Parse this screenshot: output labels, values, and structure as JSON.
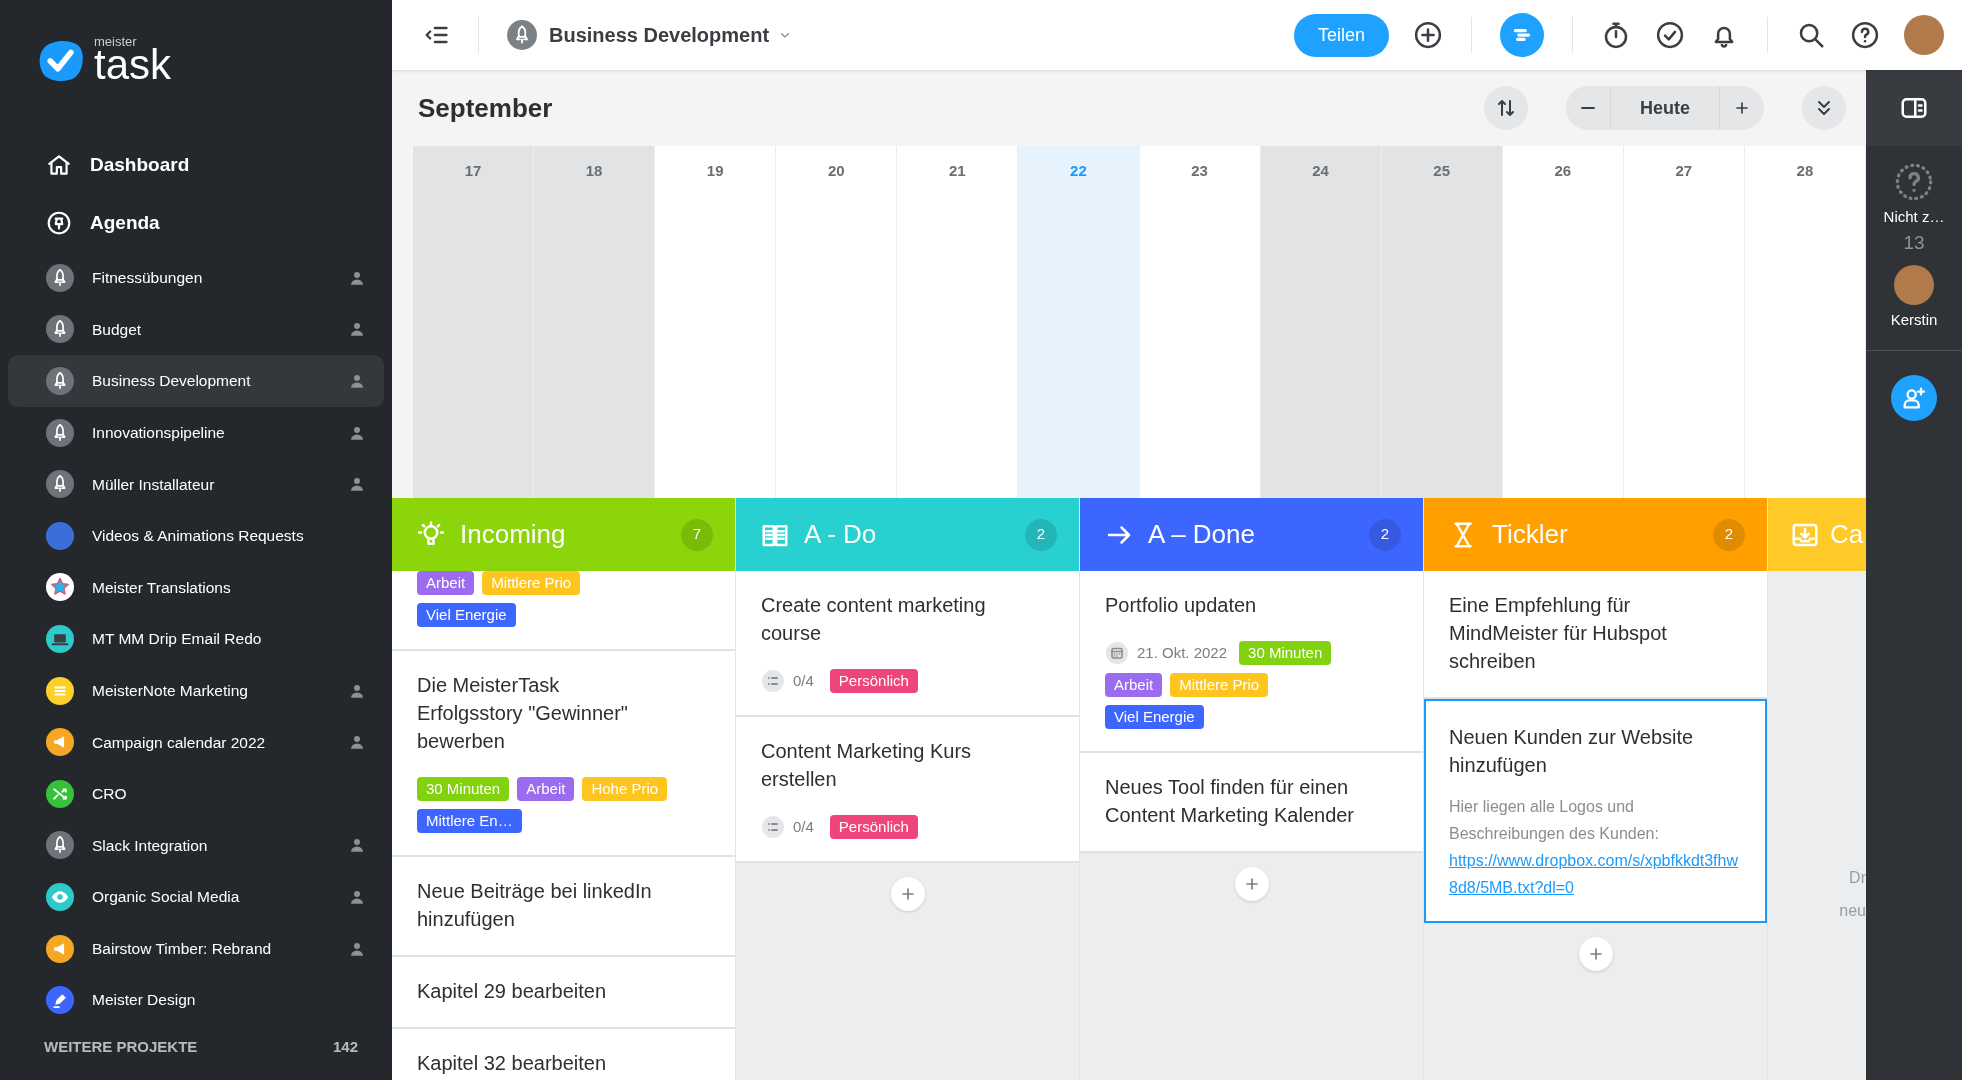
{
  "sidebar": {
    "logo": {
      "small": "meister",
      "big": "task"
    },
    "nav": [
      {
        "label": "Dashboard",
        "kind": "home"
      },
      {
        "label": "Agenda",
        "kind": "pin"
      }
    ],
    "projects": [
      {
        "name": "Fitnessübungen",
        "kind": "rocket",
        "color": "#6d7378",
        "shared": true,
        "selected": false
      },
      {
        "name": "Budget",
        "kind": "rocket",
        "color": "#6d7378",
        "shared": true,
        "selected": false
      },
      {
        "name": "Business Development",
        "kind": "rocket",
        "color": "#6d7378",
        "shared": true,
        "selected": true
      },
      {
        "name": "Innovationspipeline",
        "kind": "rocket",
        "color": "#6d7378",
        "shared": true,
        "selected": false
      },
      {
        "name": "Müller Installateur",
        "kind": "rocket",
        "color": "#6d7378",
        "shared": true,
        "selected": false
      },
      {
        "name": "Videos & Animations Requests",
        "kind": "avatar",
        "color": "#3b6fd8",
        "shared": false,
        "selected": false
      },
      {
        "name": "Meister Translations",
        "kind": "star",
        "color": "#ffffff",
        "shared": false,
        "selected": false
      },
      {
        "name": "MT MM Drip Email Redo",
        "kind": "laptop",
        "color": "#2ec9c9",
        "shared": false,
        "selected": false
      },
      {
        "name": "MeisterNote Marketing",
        "kind": "note",
        "color": "#ffd02a",
        "shared": true,
        "selected": false
      },
      {
        "name": "Campaign calendar 2022",
        "kind": "megaphone",
        "color": "#f5a623",
        "shared": true,
        "selected": false
      },
      {
        "name": "CRO",
        "kind": "shuffle",
        "color": "#35c13a",
        "shared": false,
        "selected": false
      },
      {
        "name": "Slack Integration",
        "kind": "rocket",
        "color": "#6d7378",
        "shared": true,
        "selected": false
      },
      {
        "name": "Organic Social Media",
        "kind": "eye",
        "color": "#2ec9c9",
        "shared": true,
        "selected": false
      },
      {
        "name": "Bairstow Timber: Rebrand",
        "kind": "megaphone",
        "color": "#f5a623",
        "shared": true,
        "selected": false
      },
      {
        "name": "Meister Design",
        "kind": "pen",
        "color": "#3d66ff",
        "shared": false,
        "selected": false
      }
    ],
    "more": {
      "label": "WEITERE PROJEKTE",
      "count": "142"
    }
  },
  "topbar": {
    "project": "Business Development",
    "share_button": "Teilen"
  },
  "calendar": {
    "month": "September",
    "today_button": "Heute",
    "days": [
      {
        "label": "17",
        "weekend": true,
        "selected": false
      },
      {
        "label": "18",
        "weekend": true,
        "selected": false
      },
      {
        "label": "19",
        "weekend": false,
        "selected": false
      },
      {
        "label": "20",
        "weekend": false,
        "selected": false
      },
      {
        "label": "21",
        "weekend": false,
        "selected": false
      },
      {
        "label": "22",
        "weekend": false,
        "selected": true
      },
      {
        "label": "23",
        "weekend": false,
        "selected": false
      },
      {
        "label": "24",
        "weekend": true,
        "selected": false
      },
      {
        "label": "25",
        "weekend": true,
        "selected": false
      },
      {
        "label": "26",
        "weekend": false,
        "selected": false
      },
      {
        "label": "27",
        "weekend": false,
        "selected": false
      },
      {
        "label": "28",
        "weekend": false,
        "selected": false
      }
    ]
  },
  "board": {
    "sections": [
      {
        "title": "Incoming",
        "kind": "bulb",
        "color": "#8bd50a",
        "count": "7",
        "cards": [
          {
            "tags": [
              {
                "text": "Arbeit",
                "color": "#9b6bf0"
              },
              {
                "text": "Mittlere Prio",
                "color": "#ffc51f"
              },
              {
                "text": "Viel Energie",
                "color": "#3d66ff"
              }
            ],
            "selected": false
          },
          {
            "title": "Die MeisterTask Erfolgsstory \"Gewinner\" bewerben",
            "tags": [
              {
                "text": "30 Minuten",
                "color": "#82d20f"
              },
              {
                "text": "Arbeit",
                "color": "#9b6bf0"
              },
              {
                "text": "Hohe Prio",
                "color": "#ffc51f"
              },
              {
                "text": "Mittlere En…",
                "color": "#3d66ff"
              }
            ],
            "selected": false
          },
          {
            "title": "Neue Beiträge bei linkedIn hinzufügen",
            "selected": false
          },
          {
            "title": "Kapitel 29 bearbeiten",
            "selected": false
          },
          {
            "title": "Kapitel 32 bearbeiten",
            "selected": false
          }
        ]
      },
      {
        "title": "A - Do",
        "kind": "book",
        "color": "#28d0d0",
        "count": "2",
        "add_button": true,
        "cards": [
          {
            "title": "Create content marketing course",
            "checklist": "0/4",
            "tags": [
              {
                "text": "Persönlich",
                "color": "#f0457a"
              }
            ],
            "selected": false
          },
          {
            "title": "Content Marketing Kurs erstellen",
            "checklist": "0/4",
            "tags": [
              {
                "text": "Persönlich",
                "color": "#f0457a"
              }
            ],
            "selected": false
          }
        ]
      },
      {
        "title": "A – Done",
        "kind": "arrow",
        "color": "#3d66ff",
        "count": "2",
        "add_button": true,
        "cards": [
          {
            "title": "Portfolio updaten",
            "due": "21. Okt. 2022",
            "tags": [
              {
                "text": "30 Minuten",
                "color": "#82d20f"
              },
              {
                "text": "Arbeit",
                "color": "#9b6bf0"
              },
              {
                "text": "Mittlere Prio",
                "color": "#ffc51f"
              },
              {
                "text": "Viel Energie",
                "color": "#3d66ff"
              }
            ],
            "selected": false
          },
          {
            "title": "Neues Tool finden für einen Content Marketing Kalender",
            "selected": false
          }
        ]
      },
      {
        "title": "Tickler",
        "kind": "hourglass",
        "color": "#ffa000",
        "count": "2",
        "add_button": true,
        "cards": [
          {
            "title": "Eine Empfehlung für MindMeister für Hubspot schreiben",
            "selected": false
          },
          {
            "title": "Neuen Kunden zur Website hinzufügen",
            "description": "Hier liegen alle Logos und Beschreibungen des Kunden:",
            "link": "https://www.dropbox.com/s/xpbfkkdt3fhw8d8/5MB.txt?dl=0",
            "selected": true
          }
        ]
      },
      {
        "title": "Ca",
        "kind": "inbox",
        "color": "#ffc928",
        "add_button": false,
        "empty_text": [
          "Dr",
          "neu"
        ]
      }
    ]
  },
  "right_rail": {
    "unassigned": {
      "label": "Nicht z…",
      "count": "13"
    },
    "members": [
      {
        "name": "Kerstin"
      }
    ]
  }
}
